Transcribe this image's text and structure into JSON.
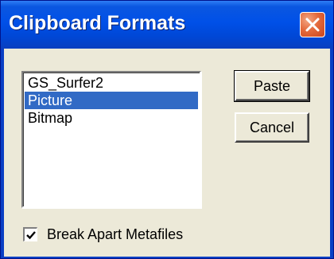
{
  "dialog": {
    "title": "Clipboard Formats",
    "close_icon": "close-x-icon",
    "formats": [
      {
        "label": "GS_Surfer2",
        "selected": false
      },
      {
        "label": "Picture",
        "selected": true
      },
      {
        "label": "Bitmap",
        "selected": false
      }
    ],
    "buttons": {
      "paste_label": "Paste",
      "cancel_label": "Cancel"
    },
    "break_apart": {
      "label": "Break Apart Metafiles",
      "checked": true
    },
    "colors": {
      "titlebar": "#0050e8",
      "close_button": "#e46a3c",
      "selection": "#316ac5",
      "dialog_face": "#ece9d8"
    }
  }
}
